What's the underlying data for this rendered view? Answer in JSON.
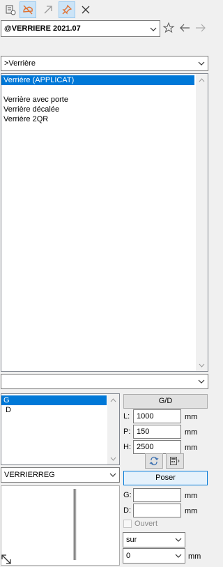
{
  "toolbar": {
    "icons": [
      "properties-icon",
      "hide-icon",
      "arrow-icon",
      "pin-icon",
      "close-icon"
    ]
  },
  "header": {
    "catalog_value": "@VERRIERE 2021.07"
  },
  "family_select": {
    "value": ">Verrière"
  },
  "product_list": {
    "items": [
      {
        "label": "Verrière (APPLICAT)",
        "selected": true
      },
      {
        "label": "",
        "selected": false
      },
      {
        "label": "Verrière avec porte",
        "selected": false
      },
      {
        "label": "Verrière décalée",
        "selected": false
      },
      {
        "label": "Verrière 2QR",
        "selected": false
      }
    ]
  },
  "option_select": {
    "value": ""
  },
  "side_list": {
    "items": [
      {
        "label": "G",
        "selected": true
      },
      {
        "label": "D",
        "selected": false
      }
    ]
  },
  "gd_button": "G/D",
  "dimensions": {
    "L": {
      "label": "L:",
      "value": "1000",
      "unit": "mm"
    },
    "P": {
      "label": "P:",
      "value": "150",
      "unit": "mm"
    },
    "H": {
      "label": "H:",
      "value": "2500",
      "unit": "mm"
    }
  },
  "ref_select": {
    "value": "VERRIERREG"
  },
  "poser_button": "Poser",
  "offsets": {
    "G": {
      "label": "G:",
      "value": "",
      "unit": "mm"
    },
    "D": {
      "label": "D:",
      "value": "",
      "unit": "mm"
    }
  },
  "ouvert": {
    "label": "Ouvert",
    "checked": false
  },
  "position_select": {
    "value": "sur"
  },
  "position_value": {
    "value": "0",
    "unit": "mm"
  },
  "colors": {
    "selection": "#0078d7",
    "active_button": "#cce4f7",
    "hide_icon": "#e07030"
  }
}
